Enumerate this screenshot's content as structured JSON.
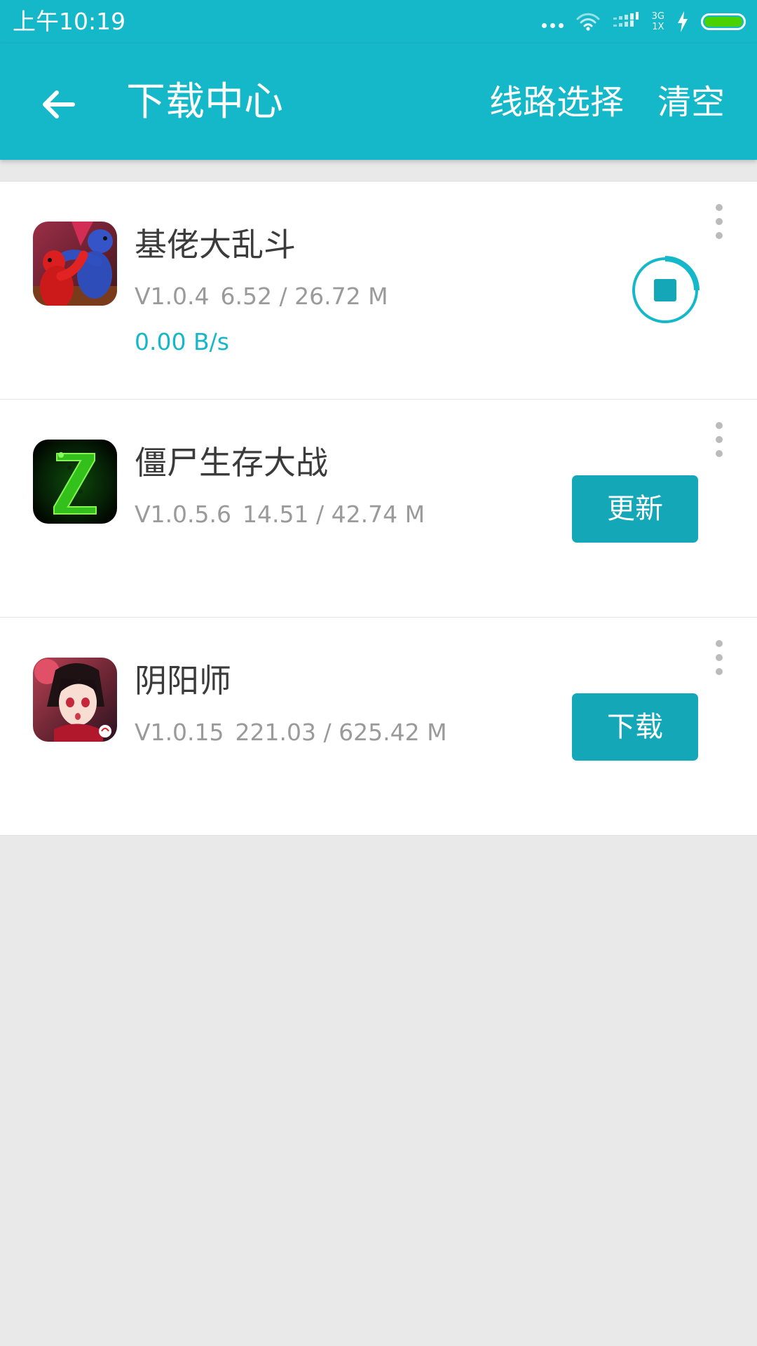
{
  "status_bar": {
    "time": "上午10:19",
    "network_top": "3G",
    "network_bottom": "1X",
    "battery_color": "#4bd000"
  },
  "app_bar": {
    "background_color": "#14b8c8",
    "back_icon": "back-arrow-icon",
    "title": "下载中心",
    "route_select_label": "线路选择",
    "clear_label": "清空"
  },
  "downloads": [
    {
      "name": "基佬大乱斗",
      "version": "V1.0.4",
      "progress": "6.52 / 26.72 M",
      "speed": "0.00 B/s",
      "action": "stop",
      "action_icon": "stop-download-icon",
      "icon": "gang-beasts-icon"
    },
    {
      "name": "僵尸生存大战",
      "version": "V1.0.5.6",
      "progress": "14.51 / 42.74 M",
      "action_label": "更新",
      "icon": "zombie-z-icon"
    },
    {
      "name": "阴阳师",
      "version": "V1.0.15",
      "progress": "221.03 / 625.42 M",
      "action_label": "下载",
      "icon": "onmyoji-icon"
    }
  ],
  "accent_color": "#14b8c8",
  "button_color": "#14a7b7"
}
